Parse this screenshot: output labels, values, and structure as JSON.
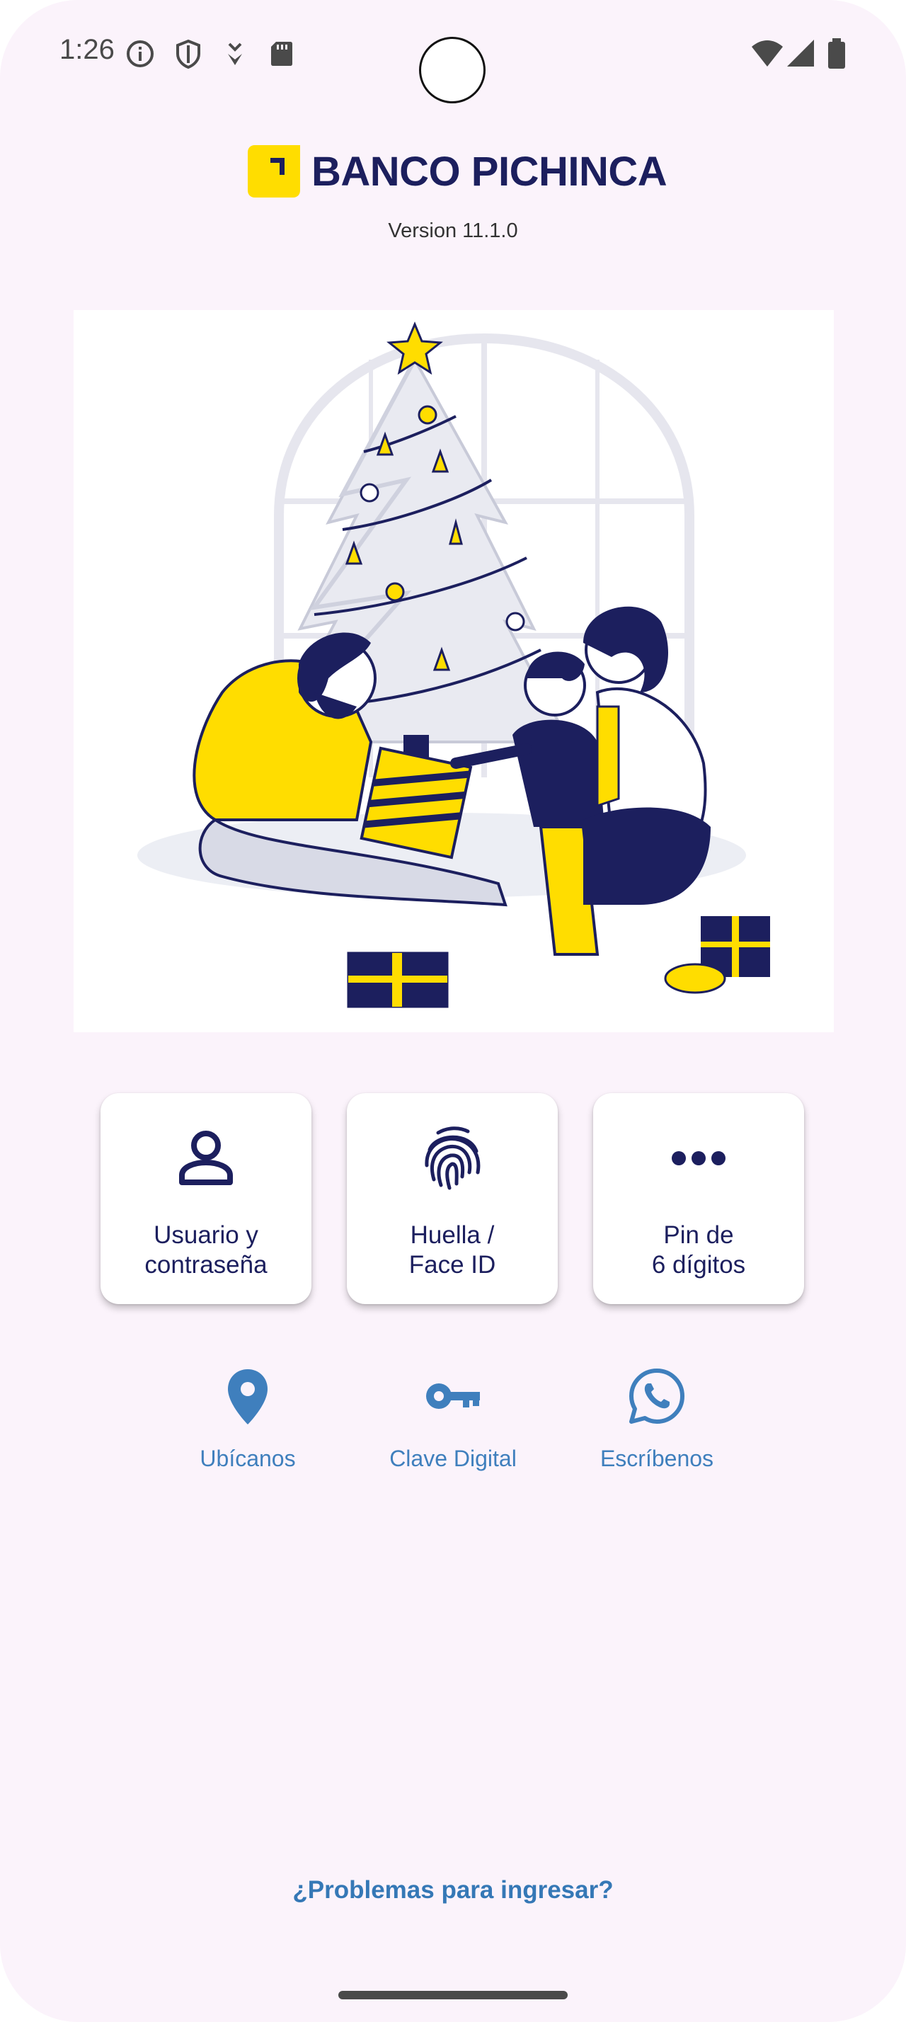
{
  "status_bar": {
    "time": "1:26",
    "icons": [
      "info-icon",
      "shield-icon",
      "download-icon",
      "sd-card-icon",
      "wifi-icon",
      "signal-icon",
      "battery-icon"
    ]
  },
  "brand": {
    "name": "BANCO PICHINCA",
    "version": "Version 11.1.0",
    "colors": {
      "navy": "#1c1f5e",
      "yellow": "#ffdd00",
      "link_blue": "#3f7fbd"
    }
  },
  "hero": {
    "illustration": "christmas-family-illustration"
  },
  "login_options": [
    {
      "label": "Usuario y\ncontraseña",
      "icon": "user-icon"
    },
    {
      "label": "Huella /\nFace ID",
      "icon": "fingerprint-icon"
    },
    {
      "label": "Pin de\n6 dígitos",
      "icon": "dots-icon"
    }
  ],
  "quick_links": [
    {
      "label": "Ubícanos",
      "icon": "location-pin-icon"
    },
    {
      "label": "Clave Digital",
      "icon": "key-icon"
    },
    {
      "label": "Escríbenos",
      "icon": "whatsapp-icon"
    }
  ],
  "footer": {
    "problems_link": "¿Problemas para ingresar?"
  }
}
